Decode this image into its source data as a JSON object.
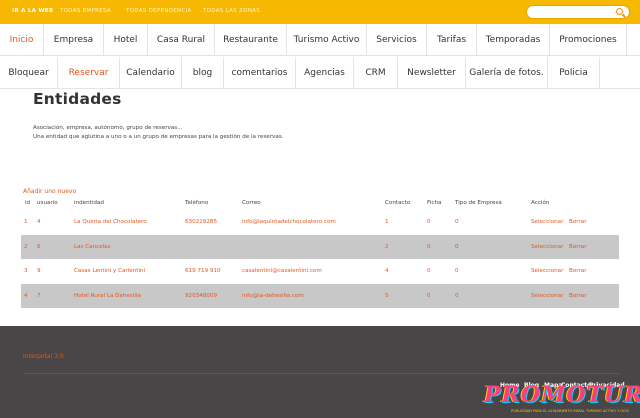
{
  "topbar": {
    "links": [
      "IR A LA WEB",
      "TODAS EMPRESA",
      "TODAS DEPENDENCIA",
      "TODAS LAS ZONAS"
    ],
    "search_placeholder": ""
  },
  "nav_primary": [
    "Inicio",
    "Empresa",
    "Hotel",
    "Casa Rural",
    "Restaurante",
    "Turismo Activo",
    "Servicios",
    "Tarifas",
    "Temporadas",
    "Promociones"
  ],
  "nav_secondary": [
    "Bloquear",
    "Reservar",
    "Calendario",
    "blog",
    "comentarios",
    "Agencias",
    "CRM",
    "Newsletter",
    "Galería de fotos.",
    "Policia"
  ],
  "page": {
    "title": "Entidades",
    "description_1": "Asociación, empresa, autónomo, grupo de reservas...",
    "description_2": "Una entidad que aglutina a uno o a un grupo de empresas para la gestión de la reservas.",
    "add_link": "Añadir uno nuevo"
  },
  "table": {
    "headers": [
      "id",
      "usuario",
      "indentidad",
      "Teléfono",
      "Correo",
      "Contacto",
      "Ficha",
      "Tipo de Empresa",
      "Acción"
    ],
    "action_select": "Seleccionar",
    "action_delete": "Borrar",
    "rows": [
      {
        "id": "1",
        "usuario": "4",
        "identidad": "La Quinta del Chocolatero",
        "telefono": "630229285",
        "correo": "info@laquintadelchocolatero.com",
        "contacto": "1",
        "ficha": "0",
        "tipo": "0"
      },
      {
        "id": "2",
        "usuario": "6",
        "identidad": "Las Cancelas",
        "telefono": "",
        "correo": "",
        "contacto": "2",
        "ficha": "0",
        "tipo": "0"
      },
      {
        "id": "3",
        "usuario": "9",
        "identidad": "Casas Lentini y Carlentini",
        "telefono": "619 719 910",
        "correo": "casalentini@casalentini.com",
        "contacto": "4",
        "ficha": "0",
        "tipo": "0"
      },
      {
        "id": "4",
        "usuario": "7",
        "identidad": "Hotel Rural La Dehesilla",
        "telefono": "920348009",
        "correo": "info@la-dehesilla.com",
        "contacto": "5",
        "ficha": "0",
        "tipo": "0"
      }
    ]
  },
  "footer": {
    "version": "Interpotal 3.0",
    "links": [
      "Home",
      "Blog",
      "Mapa",
      "Contacto",
      "Privacidad"
    ],
    "logo": "PROMOTUR",
    "logo_tagline": "PUBLICIDAD PARA EL ALOJAMIENTO RURAL TURISMO ACTIVO Y OCIO"
  },
  "colors": {
    "accent": "#e2571e",
    "topbar": "#f6b800",
    "footer": "#4a4546",
    "row_alt": "#c8c8c8"
  }
}
